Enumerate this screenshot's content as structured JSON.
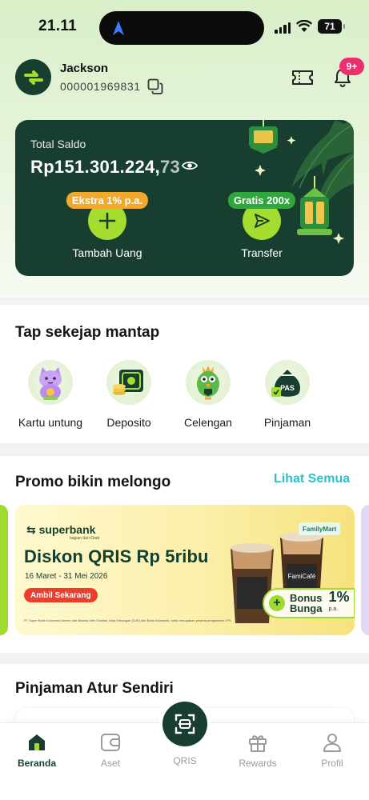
{
  "status_bar": {
    "time": "21.11",
    "battery": "71"
  },
  "header": {
    "username": "Jackson",
    "account_number": "000001969831",
    "notification_count": "9+"
  },
  "balance": {
    "label": "Total Saldo",
    "amount_main": "Rp151.301.224,",
    "amount_cents": "73",
    "actions": [
      {
        "label": "Tambah Uang",
        "tag": "Ekstra 1% p.a.",
        "icon": "plus-icon"
      },
      {
        "label": "Transfer",
        "tag": "Gratis 200x",
        "icon": "send-icon"
      }
    ]
  },
  "shortcuts": {
    "title": "Tap sekejap mantap",
    "items": [
      {
        "label": "Kartu untung",
        "icon": "lucky-cat-icon"
      },
      {
        "label": "Deposito",
        "icon": "safe-icon"
      },
      {
        "label": "Celengan",
        "icon": "mascot-bird-icon"
      },
      {
        "label": "Pinjaman",
        "icon": "money-bag-icon"
      }
    ]
  },
  "promo": {
    "title": "Promo bikin melongo",
    "see_all": "Lihat Semua",
    "banner": {
      "brand": "superbank",
      "brand_sub": "bagian dari Grab",
      "headline": "Diskon QRIS Rp 5ribu",
      "dates": "16 Maret - 31 Mei 2026",
      "cta": "Ambil Sekarang",
      "bonus_line1": "Bonus",
      "bonus_line2": "Bunga",
      "bonus_rate": "1%",
      "bonus_unit": "p.a.",
      "partner": "FamilyMart",
      "cup_label": "FamiCafé",
      "fine_print": "PT Super Bank Indonesia berizin dan diawasi oleh Otoritas Jasa Keuangan (OJK) dan Bank Indonesia, serta merupakan peserta penjaminan LPS."
    }
  },
  "loans": {
    "title": "Pinjaman Atur Sendiri"
  },
  "bottom_nav": {
    "items": [
      {
        "label": "Beranda",
        "icon": "home-icon",
        "active": true
      },
      {
        "label": "Aset",
        "icon": "wallet-icon"
      },
      {
        "label": "QRIS",
        "icon": "qris-scan-icon"
      },
      {
        "label": "Rewards",
        "icon": "gift-icon"
      },
      {
        "label": "Profil",
        "icon": "profile-icon"
      }
    ]
  },
  "colors": {
    "brand_dark": "#173e2f",
    "brand_lime": "#a5dd2e",
    "link": "#2cc0c9",
    "badge": "#ec2f6c"
  }
}
